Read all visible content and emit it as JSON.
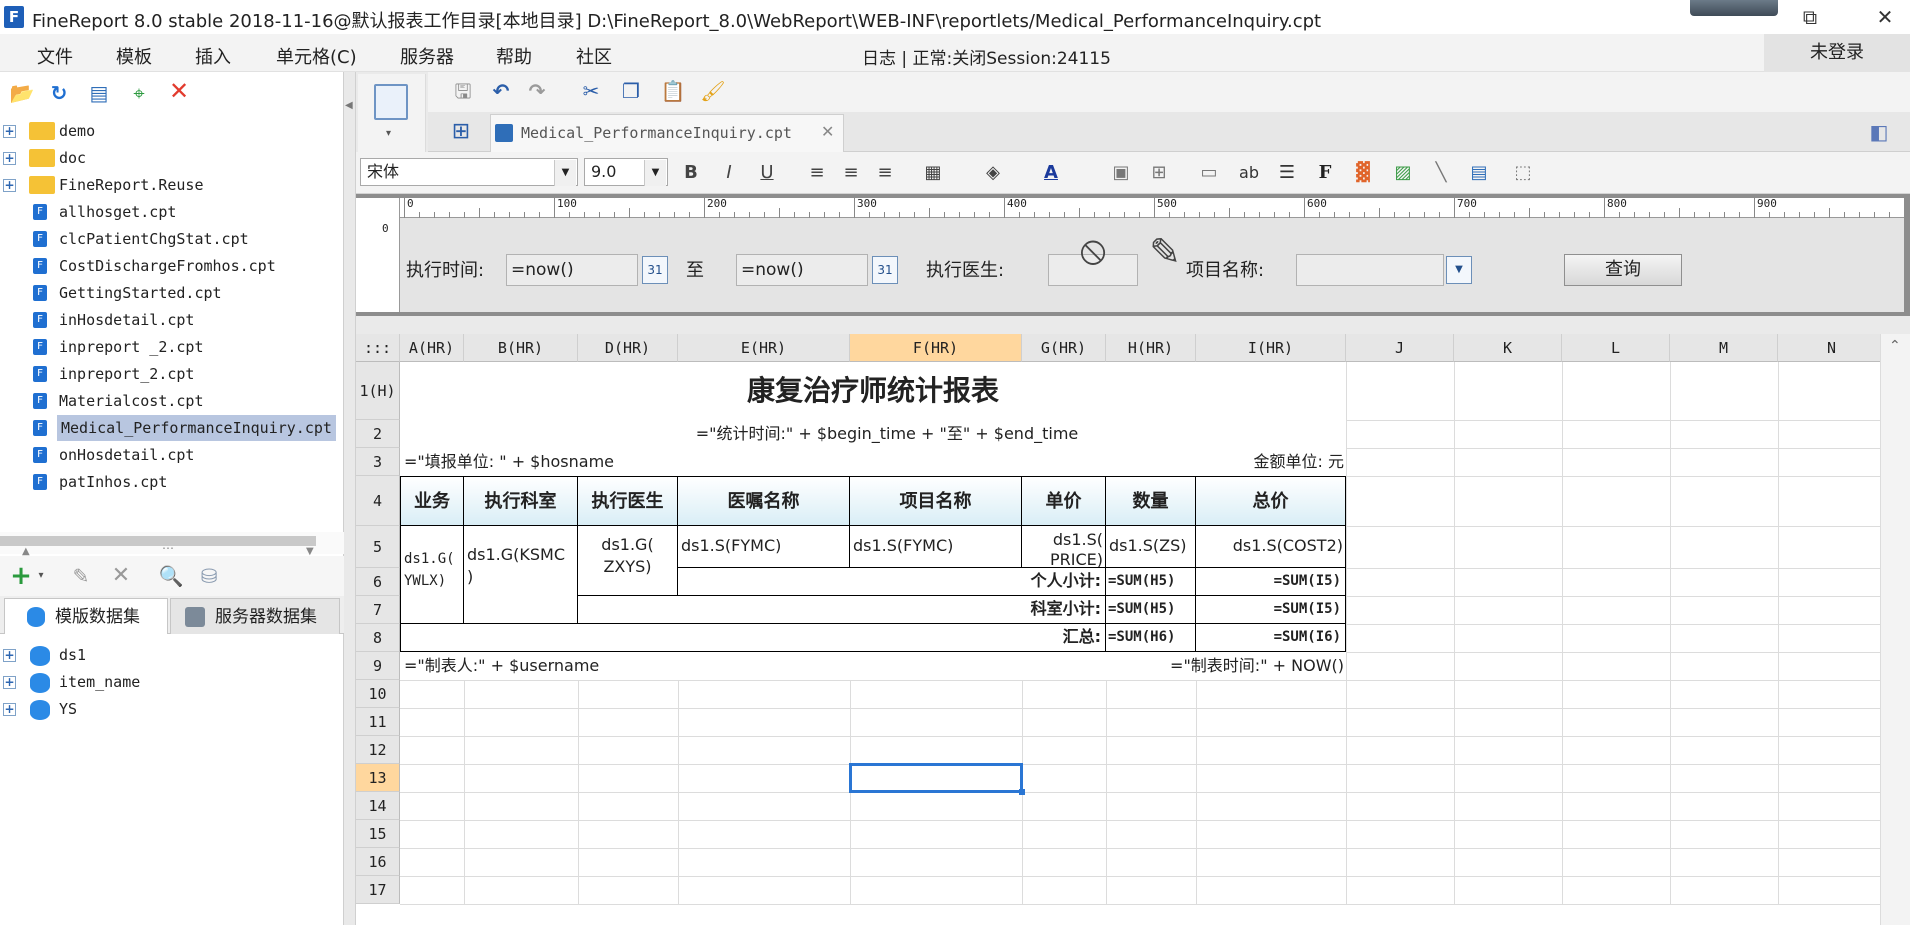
{
  "window": {
    "title": "FineReport 8.0 stable 2018-11-16@默认报表工作目录[本地目录]     D:\\FineReport_8.0\\WebReport\\WEB-INF\\reportlets/Medical_PerformanceInquiry.cpt",
    "logo_letter": "F",
    "restore_glyph": "⧉",
    "close_glyph": "✕"
  },
  "menu": {
    "items": [
      "文件",
      "模板",
      "插入",
      "单元格(C)",
      "服务器",
      "帮助",
      "社区"
    ],
    "status": "日志  |  正常:关闭Session:24115",
    "login": "未登录"
  },
  "file_tree": {
    "items": [
      {
        "label": "demo",
        "type": "folder"
      },
      {
        "label": "doc",
        "type": "folder"
      },
      {
        "label": "FineReport.Reuse",
        "type": "folder"
      },
      {
        "label": "allhosget.cpt",
        "type": "file"
      },
      {
        "label": "clcPatientChgStat.cpt",
        "type": "file"
      },
      {
        "label": "CostDischargeFromhos.cpt",
        "type": "file"
      },
      {
        "label": "GettingStarted.cpt",
        "type": "file"
      },
      {
        "label": "inHosdetail.cpt",
        "type": "file"
      },
      {
        "label": "inpreport _2.cpt",
        "type": "file"
      },
      {
        "label": "inpreport_2.cpt",
        "type": "file"
      },
      {
        "label": "Materialcost.cpt",
        "type": "file"
      },
      {
        "label": "Medical_PerformanceInquiry.cpt",
        "type": "file",
        "selected": true
      },
      {
        "label": "onHosdetail.cpt",
        "type": "file"
      },
      {
        "label": "patInhos.cpt",
        "type": "file"
      }
    ]
  },
  "dataset_panel": {
    "tab_template": "模版数据集",
    "tab_server": "服务器数据集",
    "items": [
      "ds1",
      "item_name",
      "YS"
    ]
  },
  "editor": {
    "tab_title": "Medical_PerformanceInquiry.cpt",
    "font_name": "宋体",
    "font_size": "9.0",
    "bold": "B",
    "italic": "I",
    "underline": "U",
    "ruler_labels": [
      "0",
      "100",
      "200",
      "300",
      "400",
      "500",
      "600",
      "700",
      "800",
      "900"
    ]
  },
  "params": {
    "exec_time_label": "执行时间:",
    "start_value": "=now()",
    "to_label": "至",
    "end_value": "=now()",
    "doctor_label": "执行医生:",
    "item_label": "项目名称:",
    "item_value": "",
    "query_button": "查询",
    "cal_text": "31"
  },
  "grid": {
    "corner": ":::",
    "columns": [
      "A(HR)",
      "B(HR)",
      "D(HR)",
      "E(HR)",
      "F(HR)",
      "G(HR)",
      "H(HR)",
      "I(HR)",
      "J",
      "K",
      "L",
      "M",
      "N"
    ],
    "active_column": "F(HR)",
    "rows": [
      "1(H)",
      "2",
      "3",
      "4",
      "5",
      "6",
      "7",
      "8",
      "9",
      "10",
      "11",
      "12",
      "13",
      "14",
      "15",
      "16",
      "17"
    ],
    "active_row": "13",
    "cells": {
      "title": "康复治疗师统计报表",
      "stat_time": "=\"统计时间:\" + $begin_time + \"至\" + $end_time",
      "fill_unit": "=\"填报单位: \" + $hosname",
      "amount_unit": "金额单位: 元",
      "headers": [
        "业务",
        "执行科室",
        "执行医生",
        "医嘱名称",
        "项目名称",
        "单价",
        "数量",
        "总价"
      ],
      "a5": "ds1.G(\nYWLX)",
      "b5": "ds1.G(KSMC\n)",
      "d5": "ds1.G(\nZXYS)",
      "e5": "ds1.S(FYMC)",
      "f5": "ds1.S(FYMC)",
      "g5": "ds1.S(\nPRICE)",
      "h5": "ds1.S(ZS)",
      "i5": "ds1.S(COST2)",
      "personal_subtotal": "个人小计:",
      "dept_subtotal": "科室小计:",
      "grand_total": "汇总:",
      "h6": "=SUM(H5)",
      "i6": "=SUM(I5)",
      "h7": "=SUM(H5)",
      "i7": "=SUM(I5)",
      "h8": "=SUM(H6)",
      "i8": "=SUM(I6)",
      "maker": "=\"制表人:\" + $username",
      "make_time": "=\"制表时间:\" + NOW()"
    }
  }
}
